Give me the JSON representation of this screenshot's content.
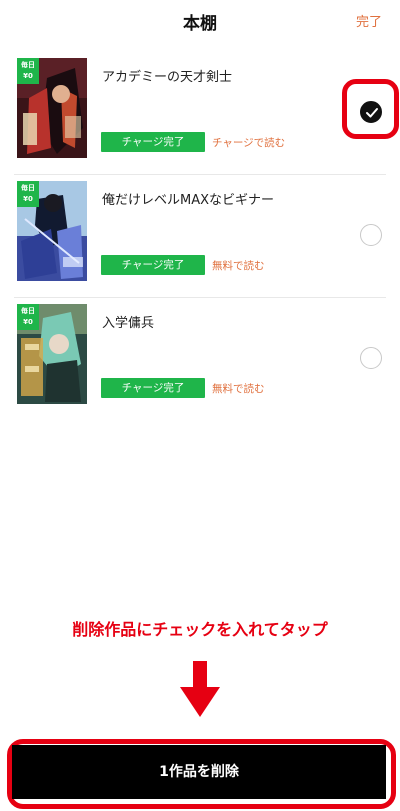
{
  "header": {
    "title": "本棚",
    "done_label": "完了"
  },
  "books": [
    {
      "title": "アカデミーの天才剣士",
      "cover_badge_line1": "毎日",
      "cover_badge_line2": "¥0",
      "charge_label": "チャージ完了",
      "read_label": "チャージで読む",
      "checked": true
    },
    {
      "title": "俺だけレベルMAXなビギナー",
      "cover_badge_line1": "毎日",
      "cover_badge_line2": "¥0",
      "charge_label": "チャージ完了",
      "read_label": "無料で読む",
      "checked": false
    },
    {
      "title": "入学傭兵",
      "cover_badge_line1": "毎日",
      "cover_badge_line2": "¥0",
      "charge_label": "チャージ完了",
      "read_label": "無料で読む",
      "checked": false
    }
  ],
  "instruction": "削除作品にチェックを入れてタップ",
  "delete_button_label": "1作品を削除",
  "colors": {
    "accent_orange": "#e0703e",
    "charge_green": "#1fb54a",
    "annotation_red": "#e60012"
  }
}
